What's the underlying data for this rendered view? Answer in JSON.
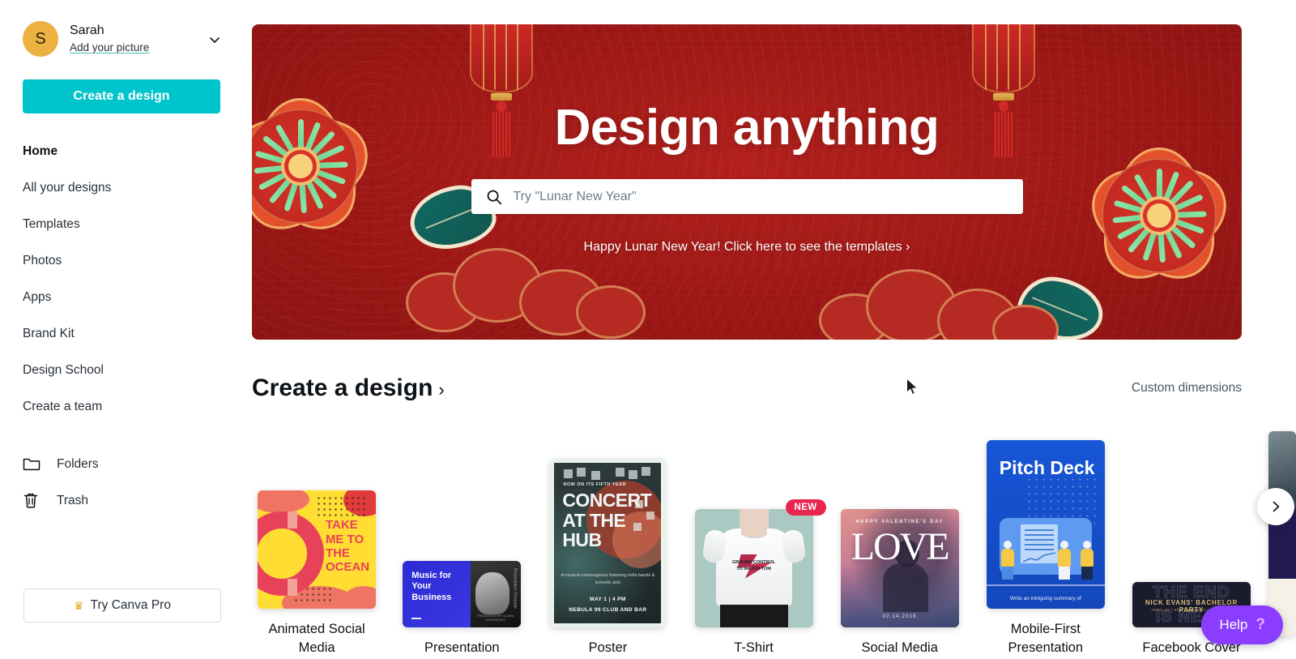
{
  "sidebar": {
    "profile": {
      "avatar_initial": "S",
      "name": "Sarah",
      "add_picture_label": "Add your picture",
      "chevron_icon": "chevron-down-icon"
    },
    "create_button_label": "Create a design",
    "nav_items": [
      {
        "label": "Home",
        "active": true
      },
      {
        "label": "All your designs",
        "active": false
      },
      {
        "label": "Templates",
        "active": false
      },
      {
        "label": "Photos",
        "active": false
      },
      {
        "label": "Apps",
        "active": false
      },
      {
        "label": "Brand Kit",
        "active": false
      },
      {
        "label": "Design School",
        "active": false
      },
      {
        "label": "Create a team",
        "active": false
      }
    ],
    "nav_icon_items": [
      {
        "label": "Folders",
        "icon": "folder-icon"
      },
      {
        "label": "Trash",
        "icon": "trash-icon"
      }
    ],
    "pro_button": {
      "label": "Try Canva Pro",
      "icon": "crown-icon",
      "icon_glyph": "♛"
    }
  },
  "hero": {
    "title": "Design anything",
    "search_placeholder": "Try \"Lunar New Year\"",
    "search_value": "",
    "search_icon": "search-icon",
    "promo_link": "Happy Lunar New Year! Click here to see the templates ›",
    "background_color": "#a81c19"
  },
  "section": {
    "title": "Create a design",
    "title_chevron": "›",
    "custom_dimensions_label": "Custom dimensions"
  },
  "cards": [
    {
      "label": "Animated Social Media",
      "badge": "",
      "art": {
        "line1": "TAKE",
        "line2": "ME TO",
        "line3": "THE",
        "line4": "OCEAN"
      }
    },
    {
      "label": "Presentation",
      "badge": "",
      "art": {
        "heading": "Music for\nYour\nBusiness",
        "vertical_text": "Presentation Template",
        "credit": "PRESENTED BY CLARA RODRIGUEZ"
      }
    },
    {
      "label": "Poster",
      "badge": "",
      "art": {
        "kicker": "NOW ON ITS FIFTH YEAR",
        "title": "CONCERT AT THE HUB",
        "description": "A musical extravaganza featuring indie bands & acoustic acts",
        "when": "MAY 1 | 4 PM",
        "where": "NEBULA 99 CLUB AND BAR"
      }
    },
    {
      "label": "T-Shirt",
      "badge": "NEW",
      "art": {
        "print": "GROUND CONTROL TO MAJOR TOM"
      }
    },
    {
      "label": "Social Media",
      "badge": "",
      "art": {
        "top": "HAPPY VALENTINE'S DAY",
        "word": "LOVE",
        "date": "02.14.2019"
      }
    },
    {
      "label": "Mobile-First Presentation",
      "badge": "",
      "art": {
        "title": "Pitch Deck",
        "caption": "Write an intriguing summary of"
      }
    },
    {
      "label": "Facebook Cover",
      "badge": "",
      "art": {
        "ghost_top": "THE END",
        "ghost_bottom": "IS NEAR",
        "gold": "NICK EVANS' BACHELOR PARTY",
        "sub": "APRIL 22 | 6PM | MOON 87 LAS VEGAS"
      }
    }
  ],
  "carousel": {
    "next_icon": "chevron-right-icon"
  },
  "help": {
    "label": "Help",
    "question_glyph": "?",
    "color": "#8b3dff"
  },
  "colors": {
    "accent_teal": "#00c4cc",
    "avatar": "#edb142",
    "badge_red": "#e8254f",
    "help_purple": "#8b3dff"
  }
}
